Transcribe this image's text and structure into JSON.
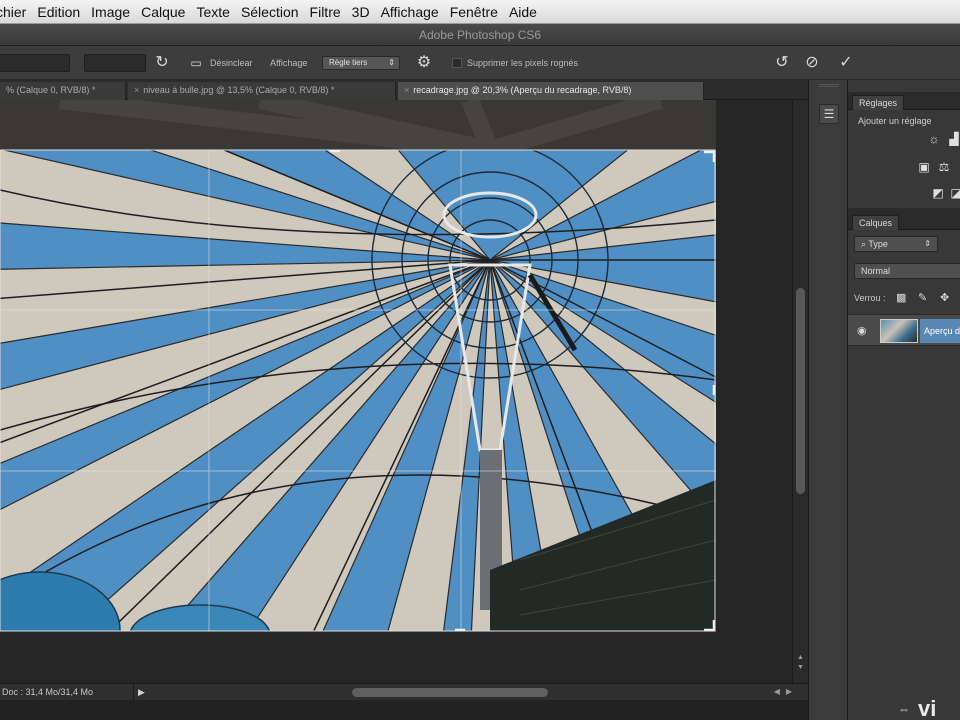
{
  "menu": [
    "chier",
    "Edition",
    "Image",
    "Calque",
    "Texte",
    "Sélection",
    "Filtre",
    "3D",
    "Affichage",
    "Fenêtre",
    "Aide"
  ],
  "window": {
    "title": "Adobe Photoshop CS6"
  },
  "options": {
    "clear_label": "Désinclear",
    "view_label": "Affichage",
    "view_value": "Règle tiers",
    "delete_pixels_label": "Supprimer les pixels rognés"
  },
  "tabs": [
    {
      "label": "% (Calque 0, RVB/8) *"
    },
    {
      "label": "niveau à bulle.jpg @ 13,5% (Calque 0, RVB/8) *"
    },
    {
      "label": "recadrage.jpg @ 20,3% (Aperçu du recadrage, RVB/8)"
    }
  ],
  "status": {
    "doc": "Doc : 31,4 Mo/31,4 Mo"
  },
  "panels": {
    "adjustments_tab": "Réglages",
    "adjustments_title": "Ajouter un réglage",
    "layers_tab": "Calques",
    "filter_type": "Type",
    "blend_mode": "Normal",
    "lock_label": "Verrou :",
    "layer_name": "Aperçu d"
  },
  "watermark": "vi",
  "colors": {
    "sky": "#4f8fc4",
    "canvas": "#262626",
    "panel": "#383838",
    "selected_layer": "#5a88b4"
  }
}
